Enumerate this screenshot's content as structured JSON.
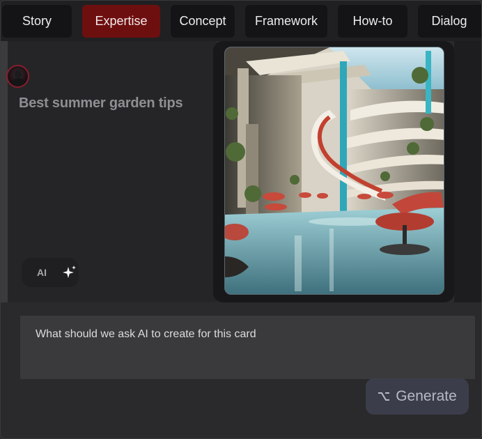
{
  "tabs": [
    {
      "label": "Story"
    },
    {
      "label": "Expertise",
      "active": true
    },
    {
      "label": "Concept"
    },
    {
      "label": "Framework"
    },
    {
      "label": "How-to"
    },
    {
      "label": "Dialog"
    }
  ],
  "card": {
    "title": "Best summer garden tips",
    "ai_label": "AI"
  },
  "prompt": {
    "placeholder": "What should we ask AI to create for this card"
  },
  "generate": {
    "label": "Generate",
    "icon": "option-key-icon"
  },
  "colors": {
    "active_tab": "#6e0f0f",
    "tab_bg": "#141416",
    "avatar_ring": "#8a1f2d"
  }
}
